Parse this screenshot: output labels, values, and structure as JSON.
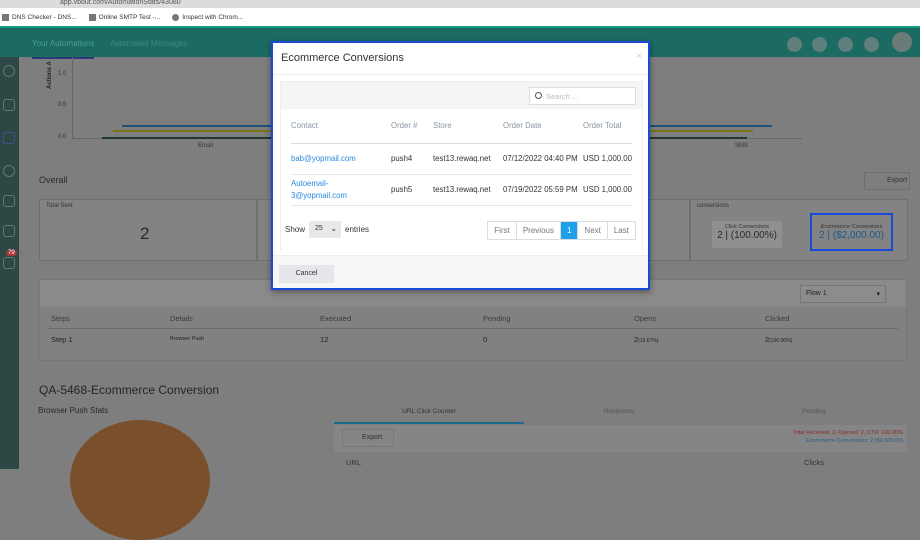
{
  "browser": {
    "url": "app.vbout.com/AutomationStats/43080",
    "bookmarks": [
      "DNS Checker - DNS...",
      "Online SMTP Test -...",
      "Inspect with Chrom..."
    ]
  },
  "header": {
    "tabs": [
      "Your Automations",
      "Automated Messages"
    ],
    "notification_badge": "79"
  },
  "chart": {
    "y_label": "Actions A",
    "y_ticks": [
      "1.0",
      "0.5",
      "0.0"
    ],
    "x_labels": [
      "Email",
      "SMS"
    ]
  },
  "overall": {
    "title": "Overall",
    "export_label": "Export",
    "total_sent_label": "Total Sent",
    "total_sent_value": "2",
    "conversions_label": "conversions",
    "click_conv_label": "Click Conversions",
    "click_conv_value": "2 | (100.00%)",
    "ecom_conv_label": "Ecommerce Conversions",
    "ecom_conv_value": "2 | ($2,000.00)"
  },
  "steps": {
    "flow_select": "Flow 1",
    "headers": [
      "Steps",
      "Details",
      "Executed",
      "Pending",
      "Opens",
      "Clicked"
    ],
    "rows": [
      {
        "step": "Step 1",
        "details": "Browser Push",
        "executed": "12",
        "pending": "0",
        "opens": "2",
        "opens_pct": "(16.67%)",
        "clicked": "2",
        "clicked_pct": "(100.00%)"
      }
    ]
  },
  "section": {
    "title": "QA-5468-Ecommerce Conversion",
    "stats_title": "Browser Push Stats",
    "tabs": [
      "URL Click Counter",
      "Recipients",
      "Pending"
    ],
    "export_label": "Export",
    "summary_red": "Total Received: 2, Opened: 2, CTR: 100.00%",
    "summary_blue": "Ecommerce Conversions: 2 ($2,000.00)",
    "col_url": "URL",
    "col_clicks": "Clicks"
  },
  "modal": {
    "title": "Ecommerce Conversions",
    "close": "×",
    "search_placeholder": "Search ...",
    "columns": [
      "Contact",
      "Order #",
      "Store",
      "Order Date",
      "Order Total"
    ],
    "rows": [
      {
        "contact": "bab@yopmail.com",
        "order": "push4",
        "store": "test13.rewaq.net",
        "date": "07/12/2022 04:40 PM",
        "total": "USD 1,000.00"
      },
      {
        "contact": "Autoemail-3@yopmail.com",
        "order": "push5",
        "store": "test13.rewaq.net",
        "date": "07/19/2022 05:59 PM",
        "total": "USD 1,000.00"
      }
    ],
    "show_label": "Show",
    "entries_value": "25",
    "entries_label": "entries",
    "pager": [
      "First",
      "Previous",
      "1",
      "Next",
      "Last"
    ],
    "cancel_label": "Cancel"
  }
}
